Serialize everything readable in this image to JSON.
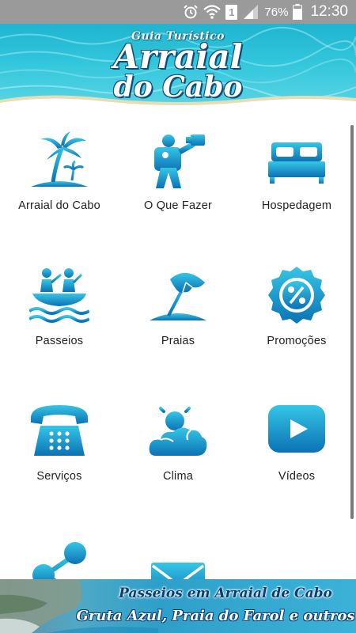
{
  "status_bar": {
    "sim_slot": "1",
    "battery": "76%",
    "time": "12:30",
    "icons": [
      "alarm-icon",
      "wifi-icon",
      "sim-icon",
      "signal-icon",
      "battery-icon"
    ]
  },
  "header": {
    "subtitle": "Guia Turístico",
    "title_line1": "Arraial",
    "title_line2": "do Cabo"
  },
  "menu": [
    {
      "label": "Arraial do Cabo",
      "icon": "palm-island-icon"
    },
    {
      "label": "O Que Fazer",
      "icon": "photographer-icon"
    },
    {
      "label": "Hospedagem",
      "icon": "bed-icon"
    },
    {
      "label": "Passeios",
      "icon": "boat-tour-icon"
    },
    {
      "label": "Praias",
      "icon": "beach-umbrella-icon"
    },
    {
      "label": "Promoções",
      "icon": "percent-badge-icon"
    },
    {
      "label": "Serviços",
      "icon": "telephone-icon"
    },
    {
      "label": "Clima",
      "icon": "weather-icon"
    },
    {
      "label": "Vídeos",
      "icon": "video-play-icon"
    },
    {
      "label": "",
      "icon": "share-icon"
    },
    {
      "label": "",
      "icon": "mail-icon"
    }
  ],
  "banner": {
    "line1": "Passeios em Arraial de Cabo",
    "line2": "Gruta Azul, Praia do Farol e outros"
  },
  "colors": {
    "icon_gradient_top": "#36c6e6",
    "icon_gradient_bottom": "#0b72b4",
    "status_bar": "#9a9a9a",
    "banner_dark_text": "#0b3d72"
  }
}
